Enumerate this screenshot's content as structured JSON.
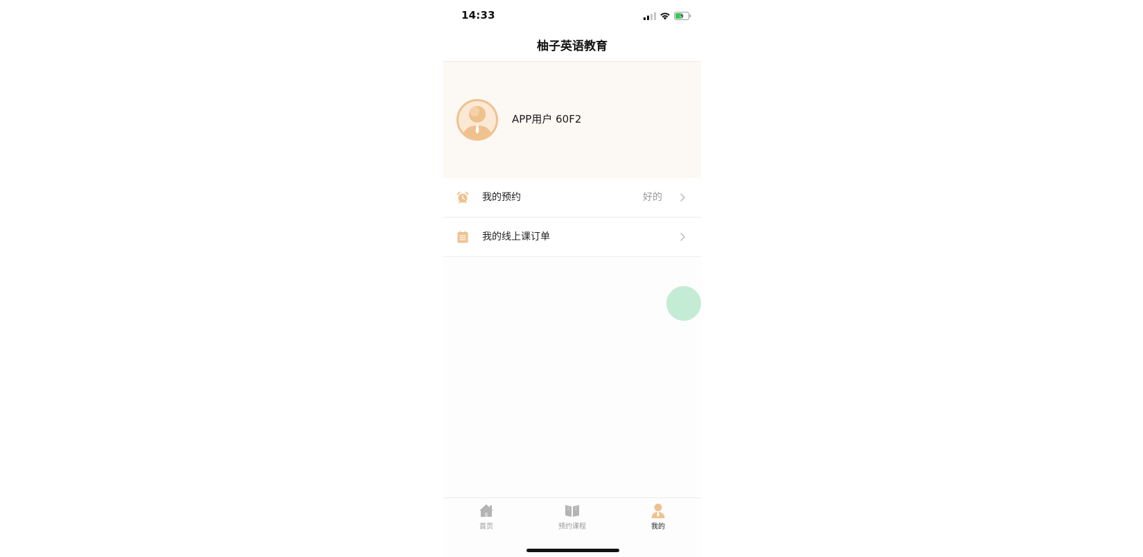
{
  "status_bar": {
    "time": "14:33",
    "icons": [
      "signal-icon",
      "wifi-icon",
      "battery-charging-icon"
    ]
  },
  "nav": {
    "title": "柚子英语教育"
  },
  "profile": {
    "username": "APP用户 60F2",
    "avatar_icon": "user-avatar-icon"
  },
  "menu": {
    "items": [
      {
        "label": "我的预约",
        "value": "好的",
        "icon": "alarm-clock-icon"
      },
      {
        "label": "我的线上课订单",
        "value": "",
        "icon": "clipboard-icon"
      }
    ]
  },
  "tabs": [
    {
      "label": "首页",
      "icon": "home-icon",
      "active": false
    },
    {
      "label": "预约课程",
      "icon": "book-icon",
      "active": false
    },
    {
      "label": "我的",
      "icon": "user-icon",
      "active": true
    }
  ],
  "colors": {
    "accent": "#eec08c",
    "profile_bg": "#fcf8f4",
    "float_button": "#c4ecd5",
    "tab_inactive": "#999999",
    "battery_green": "#34c759"
  }
}
